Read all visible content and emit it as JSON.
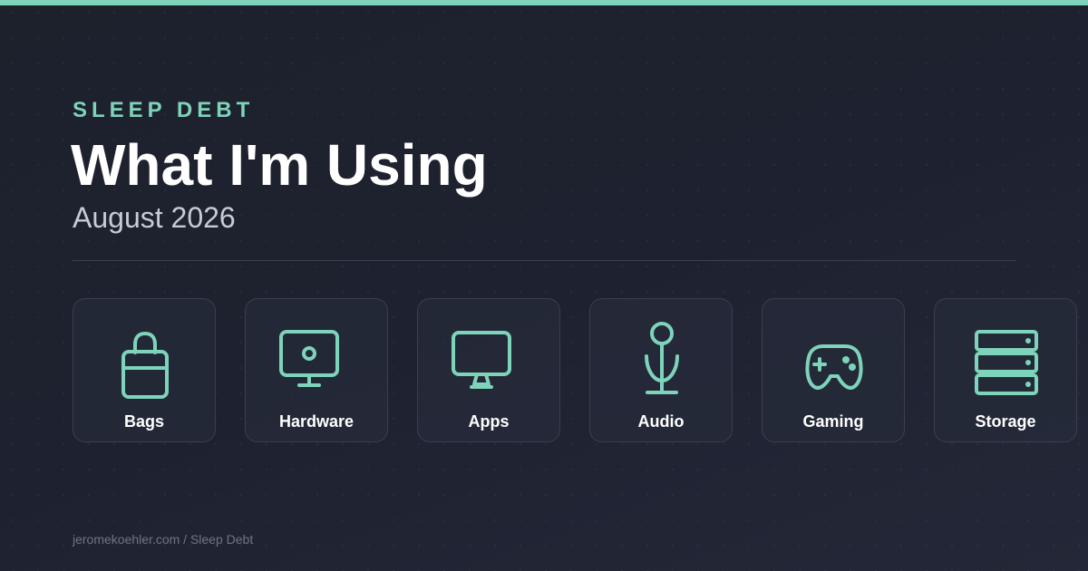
{
  "header": {
    "eyebrow": "SLEEP DEBT",
    "title": "What I'm Using",
    "subtitle": "August 2026"
  },
  "categories": [
    {
      "label": "Bags",
      "icon": "shopping-bag-icon"
    },
    {
      "label": "Hardware",
      "icon": "monitor-icon"
    },
    {
      "label": "Apps",
      "icon": "desktop-icon"
    },
    {
      "label": "Audio",
      "icon": "microphone-icon"
    },
    {
      "label": "Gaming",
      "icon": "gamepad-icon"
    },
    {
      "label": "Storage",
      "icon": "server-icon"
    }
  ],
  "footer": {
    "text": "jeromekoehler.com / Sleep Debt"
  },
  "colors": {
    "accent": "#7ed3bb",
    "background": "#1c202c",
    "card_border": "#3a3f4f",
    "title": "#ffffff",
    "subtitle": "#c7cbd4",
    "footer": "#6f7585"
  }
}
